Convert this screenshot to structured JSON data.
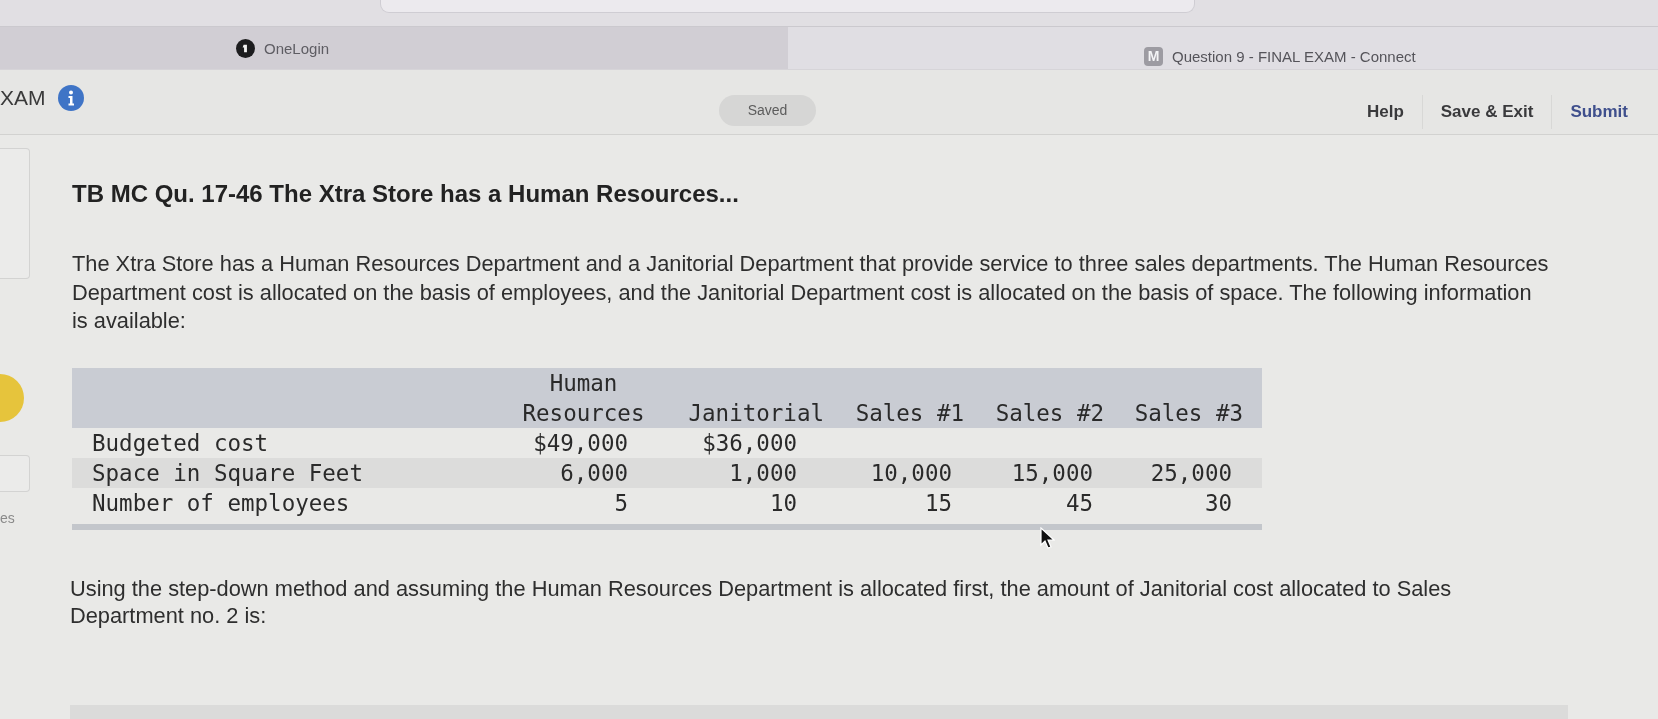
{
  "browser": {
    "tabs": [
      {
        "title": "OneLogin",
        "selected": false,
        "kind": "round"
      },
      {
        "title": "Question 9 - FINAL EXAM - Connect",
        "selected": true,
        "kind": "square",
        "icon_letter": "M"
      }
    ]
  },
  "header": {
    "title": "XAM",
    "status": "Saved",
    "links": [
      {
        "label": "Help",
        "kind": "plain"
      },
      {
        "label": "Save & Exit",
        "kind": "plain"
      },
      {
        "label": "Submit",
        "kind": "primary"
      }
    ]
  },
  "sidebar": {
    "label": "es"
  },
  "question": {
    "title": "TB MC Qu. 17-46 The Xtra Store has a Human Resources...",
    "intro": "The Xtra Store has a Human Resources Department and a Janitorial Department that provide service to three sales departments. The Human Resources Department cost is allocated on the basis of employees, and the Janitorial Department cost is allocated on the basis of space. The following information is available:",
    "table": {
      "columns": [
        "Human Resources",
        "Janitorial",
        "Sales #1",
        "Sales #2",
        "Sales #3"
      ],
      "rows": [
        {
          "label": "Budgeted cost",
          "cells": [
            "$49,000",
            "$36,000"
          ]
        },
        {
          "label": "Space in Square Feet",
          "cells": [
            "6,000",
            "1,000",
            "10,000",
            "15,000",
            "25,000"
          ]
        },
        {
          "label": "Number of employees",
          "cells": [
            "5",
            "10",
            "15",
            "45",
            "30"
          ]
        }
      ]
    },
    "prompt": "Using the step-down method and assuming the Human Resources Department is allocated first, the amount of Janitorial cost allocated to Sales Department no. 2 is:"
  }
}
